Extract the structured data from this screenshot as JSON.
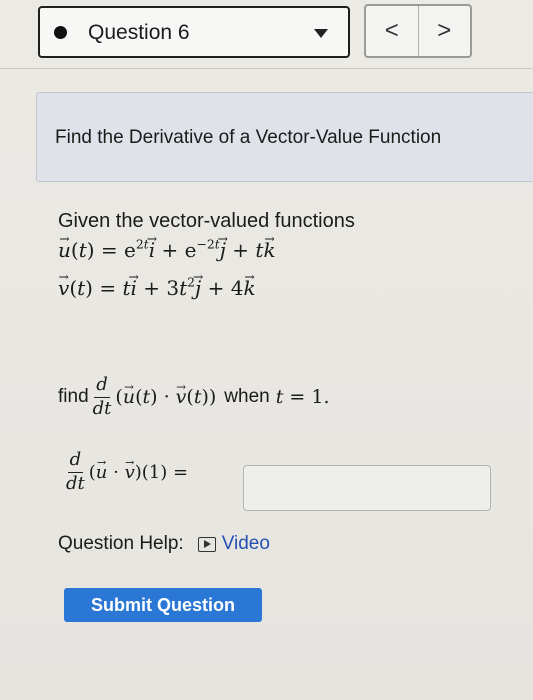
{
  "header": {
    "question_label": "Question 6",
    "prev_label": "<",
    "next_label": ">"
  },
  "problem": {
    "title": "Find the Derivative of a Vector-Value Function",
    "given_text": "Given the vector-valued functions",
    "find_word": "find",
    "deriv_num": "d",
    "deriv_den": "dt",
    "expr": "(u(t) · v(t))",
    "when_text": "when",
    "condition": "t = 1.",
    "answer_lhs": "(u · v)(1) ="
  },
  "help": {
    "label": "Question Help:",
    "video_label": "Video"
  },
  "submit_label": "Submit Question",
  "colors": {
    "accent": "#2a77d6",
    "link": "#2350b2",
    "title_bg": "#dfe2e8"
  },
  "icons": [
    "bullet-icon",
    "chevron-down-icon",
    "video-icon"
  ]
}
